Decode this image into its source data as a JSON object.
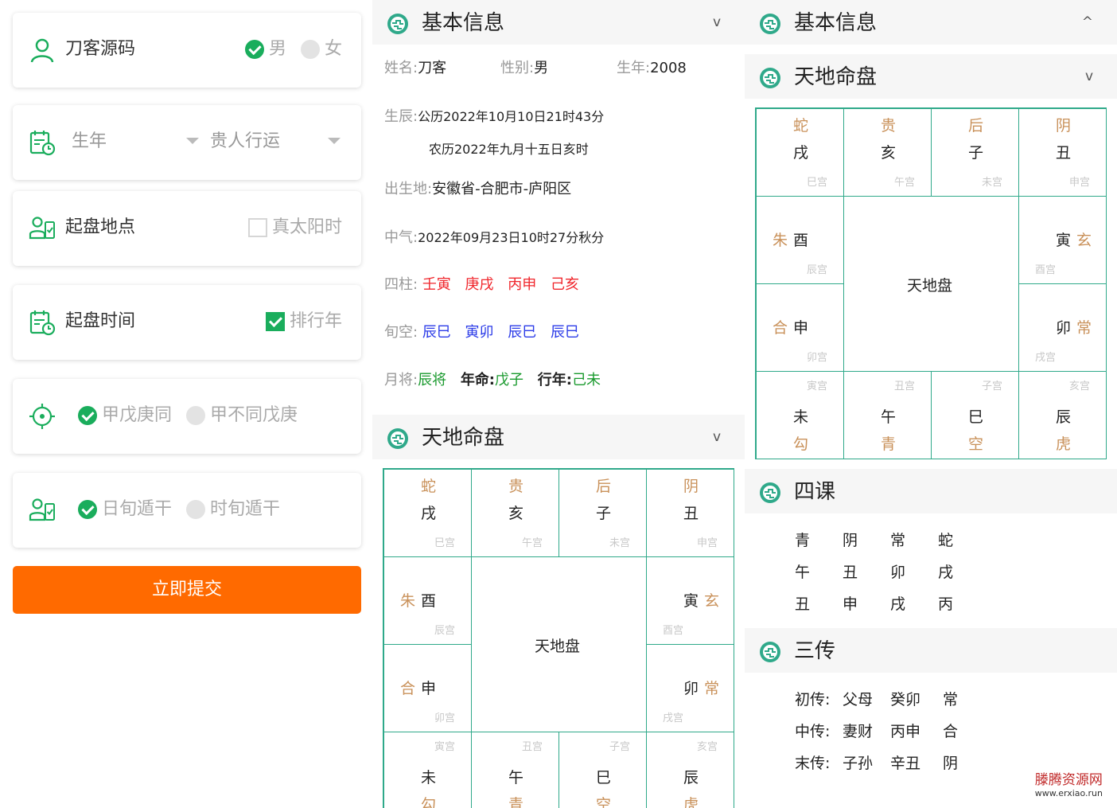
{
  "form": {
    "name_label": "刀客源码",
    "gender_male": "男",
    "gender_female": "女",
    "year_label": "生年",
    "guiren_label": "贵人行运",
    "place_label": "起盘地点",
    "true_solar_label": "真太阳时",
    "time_label": "起盘时间",
    "paixing_label": "排行年",
    "opt_jiawu_same": "甲戊庚同",
    "opt_jiawu_diff": "甲不同戊庚",
    "opt_rixun": "日旬遁干",
    "opt_shixun": "时旬遁干",
    "submit_label": "立即提交"
  },
  "basic": {
    "title": "基本信息",
    "chev_down": "v",
    "chev_up": "^",
    "name_key": "姓名:",
    "name_val": "刀客",
    "sex_key": "性别:",
    "sex_val": "男",
    "year_key": "生年:",
    "year_val": "2008",
    "shichen_key": "生辰:",
    "gongli": "公历2022年10月10日21时43分",
    "nongli": "农历2022年九月十五日亥时",
    "place_key": "出生地:",
    "place_val": "安徽省-合肥市-庐阳区",
    "zhongqi_key": "中气:",
    "zhongqi_val": "2022年09月23日10时27分秋分",
    "sizhu_key": "四柱:",
    "sizhu": [
      "壬寅",
      "庚戌",
      "丙申",
      "己亥"
    ],
    "xunkong_key": "旬空:",
    "xunkong": [
      "辰巳",
      "寅卯",
      "辰巳",
      "辰巳"
    ],
    "yuejiang_key": "月将:",
    "yuejiang_val": "辰将",
    "nianming_key": "年命:",
    "nianming_val": "戊子",
    "xingnian_key": "行年:",
    "xingnian_val": "己未"
  },
  "board": {
    "title": "天地命盘",
    "center": "天地盘",
    "top": [
      {
        "god": "蛇",
        "branch": "戌",
        "palace": "巳宫"
      },
      {
        "god": "贵",
        "branch": "亥",
        "palace": "午宫"
      },
      {
        "god": "后",
        "branch": "子",
        "palace": "未宫"
      },
      {
        "god": "阴",
        "branch": "丑",
        "palace": "申宫"
      }
    ],
    "left": [
      {
        "god": "朱",
        "branch": "酉",
        "palace": "辰宫"
      },
      {
        "god": "合",
        "branch": "申",
        "palace": "卯宫"
      }
    ],
    "right": [
      {
        "god": "玄",
        "branch": "寅",
        "palace": "酉宫"
      },
      {
        "god": "常",
        "branch": "卯",
        "palace": "戌宫"
      }
    ],
    "bottom": [
      {
        "god": "勾",
        "branch": "未",
        "palace": "寅宫"
      },
      {
        "god": "青",
        "branch": "午",
        "palace": "丑宫"
      },
      {
        "god": "空",
        "branch": "巳",
        "palace": "子宫"
      },
      {
        "god": "虎",
        "branch": "辰",
        "palace": "亥宫"
      }
    ]
  },
  "sike": {
    "title": "四课",
    "rows": [
      [
        "青",
        "阴",
        "常",
        "蛇"
      ],
      [
        "午",
        "丑",
        "卯",
        "戌"
      ],
      [
        "丑",
        "申",
        "戌",
        "丙"
      ]
    ]
  },
  "sanchuan": {
    "title": "三传",
    "rows": [
      {
        "key": "初传:",
        "rel": "父母",
        "gz": "癸卯",
        "god": "常"
      },
      {
        "key": "中传:",
        "rel": "妻财",
        "gz": "丙申",
        "god": "合"
      },
      {
        "key": "末传:",
        "rel": "子孙",
        "gz": "辛丑",
        "god": "阴"
      }
    ]
  },
  "watermark": {
    "line1": "滕腾资源网",
    "line2": "www.erxiao.run"
  },
  "colors": {
    "accent_green": "#1aad5c",
    "board_line": "#2fa98a",
    "submit_orange": "#ff6a00",
    "god_gold": "#c9915a",
    "red": "#f0262c",
    "blue": "#2b3be8",
    "green": "#1a9a2e"
  }
}
